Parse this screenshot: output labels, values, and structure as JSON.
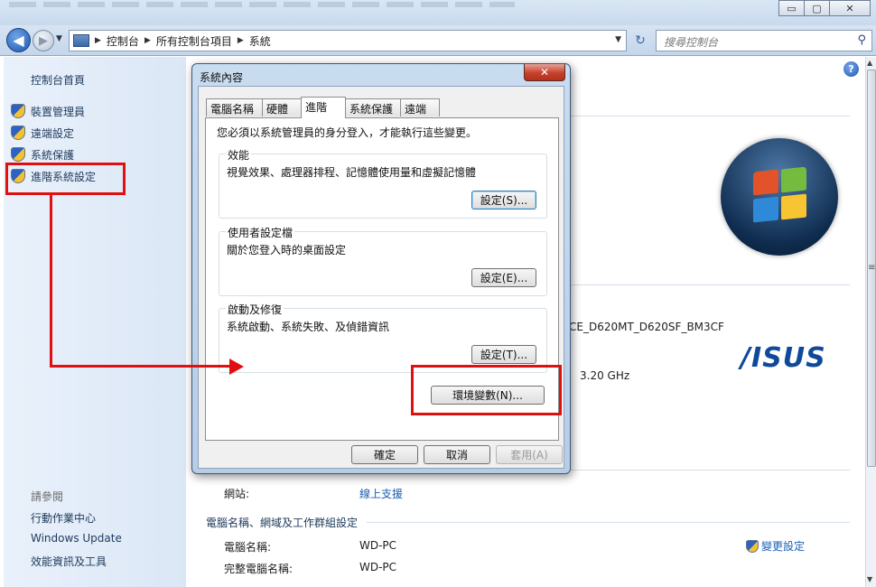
{
  "window": {
    "minimize_label": "▭",
    "maximize_label": "▢",
    "close_label": "✕"
  },
  "nav": {
    "back_icon": "◀",
    "forward_icon": "▶",
    "breadcrumbs": [
      "控制台",
      "所有控制台項目",
      "系統"
    ],
    "refresh_icon": "↻",
    "search_placeholder": "搜尋控制台"
  },
  "sidebar": {
    "home": "控制台首頁",
    "items": [
      {
        "label": "裝置管理員"
      },
      {
        "label": "遠端設定"
      },
      {
        "label": "系統保護"
      },
      {
        "label": "進階系統設定"
      }
    ],
    "see_also_title": "請參閱",
    "see_also": [
      {
        "label": "行動作業中心"
      },
      {
        "label": "Windows Update"
      },
      {
        "label": "效能資訊及工具"
      }
    ]
  },
  "main": {
    "help_label": "?",
    "model_text": "CE_D620MT_D620SF_BM3CF",
    "cpu_text": "3.20 GHz",
    "brand_logo": "/ISUS",
    "website_key": "網站:",
    "website_value": "線上支援",
    "computer_section_title": "電腦名稱、網域及工作群組設定",
    "computer_name_key": "電腦名稱:",
    "computer_name_value": "WD-PC",
    "full_name_key": "完整電腦名稱:",
    "full_name_value": "WD-PC",
    "change_settings": "變更設定"
  },
  "dialog": {
    "title": "系統內容",
    "close_label": "✕",
    "tabs": [
      {
        "label": "電腦名稱"
      },
      {
        "label": "硬體"
      },
      {
        "label": "進階"
      },
      {
        "label": "系統保護"
      },
      {
        "label": "遠端"
      }
    ],
    "admin_note": "您必須以系統管理員的身分登入，才能執行這些變更。",
    "groups": [
      {
        "title": "效能",
        "description": "視覺效果、處理器排程、記憶體使用量和虛擬記憶體",
        "button": "設定(S)..."
      },
      {
        "title": "使用者設定檔",
        "description": "關於您登入時的桌面設定",
        "button": "設定(E)..."
      },
      {
        "title": "啟動及修復",
        "description": "系統啟動、系統失敗、及偵錯資訊",
        "button": "設定(T)..."
      }
    ],
    "env_button": "環境變數(N)...",
    "ok": "確定",
    "cancel": "取消",
    "apply": "套用(A)"
  },
  "colors": {
    "annotation": "#e01010",
    "link": "#1a5fb4",
    "sidebar_text": "#1e395b"
  }
}
